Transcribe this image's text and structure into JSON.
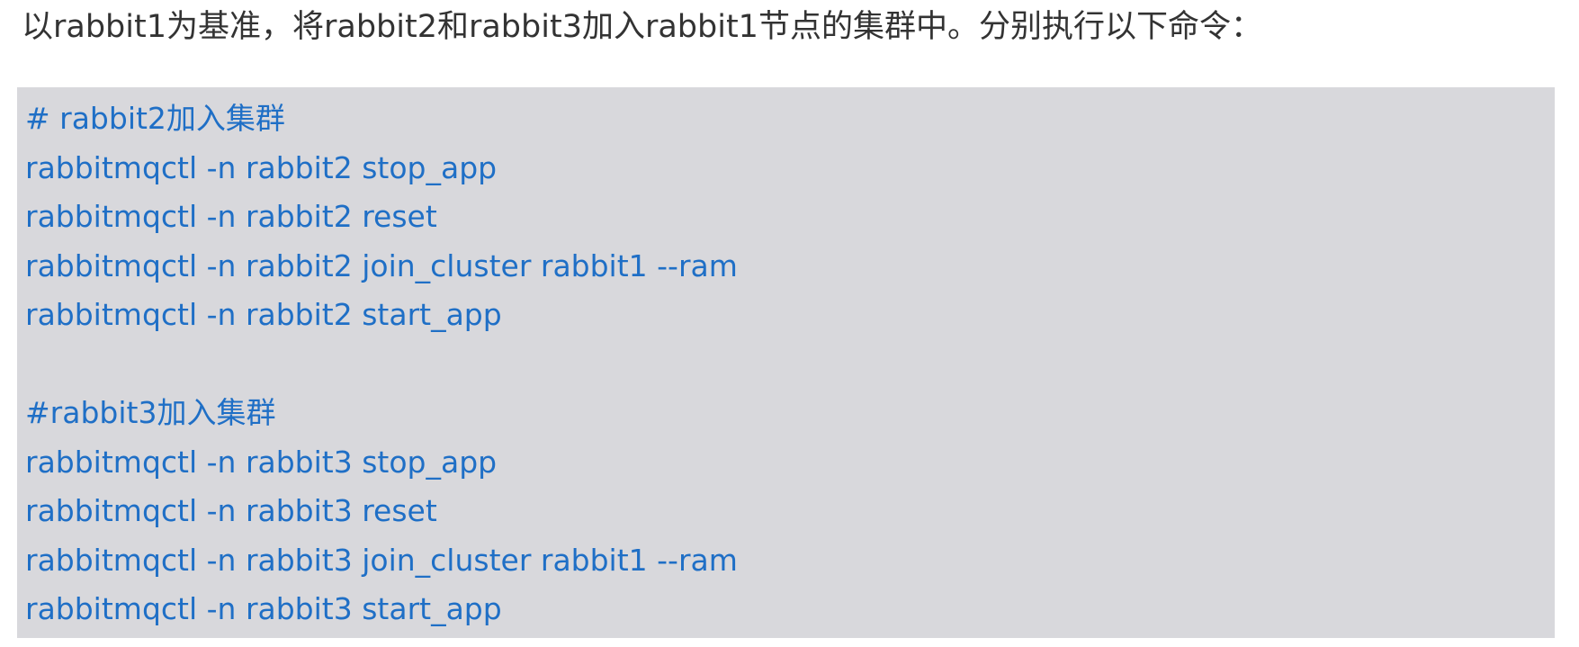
{
  "intro_text": "以rabbit1为基准，将rabbit2和rabbit3加入rabbit1节点的集群中。分别执行以下命令：",
  "code_lines": [
    "# rabbit2加入集群",
    "rabbitmqctl -n rabbit2 stop_app",
    "rabbitmqctl -n rabbit2 reset",
    "rabbitmqctl -n rabbit2 join_cluster rabbit1 --ram",
    "rabbitmqctl -n rabbit2 start_app",
    "",
    "#rabbit3加入集群",
    "rabbitmqctl -n rabbit3 stop_app",
    "rabbitmqctl -n rabbit3 reset",
    "rabbitmqctl -n rabbit3 join_cluster rabbit1 --ram",
    "rabbitmqctl -n rabbit3 start_app"
  ],
  "colors": {
    "code_text": "#1f6fc6",
    "code_background": "#d8d8dc",
    "body_text": "#333333"
  }
}
